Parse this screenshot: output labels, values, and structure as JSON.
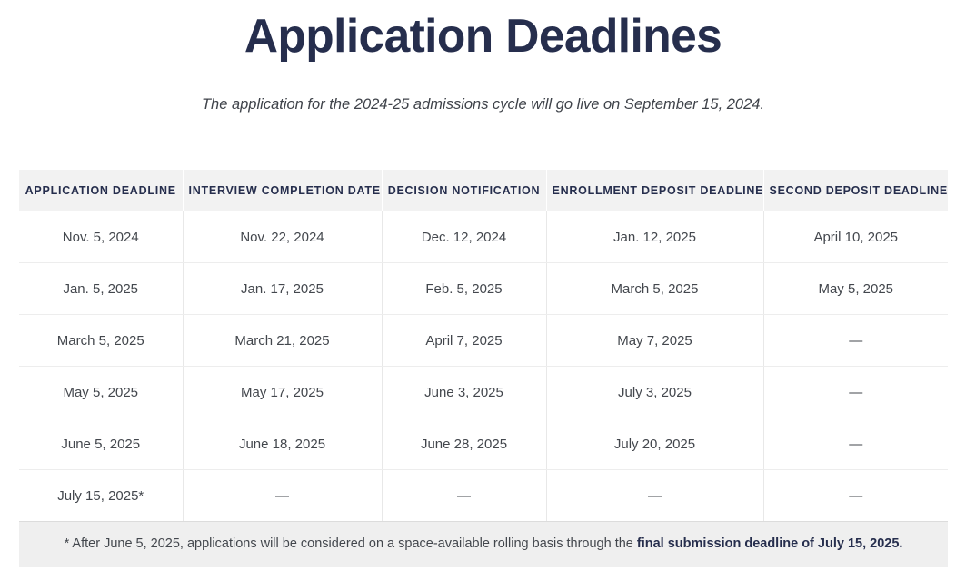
{
  "page_title": "Application Deadlines",
  "subtitle": "The application for the 2024-25 admissions cycle will go live on September 15, 2024.",
  "table": {
    "headers": [
      "APPLICATION DEADLINE",
      "INTERVIEW COMPLETION DATE",
      "DECISION NOTIFICATION",
      "ENROLLMENT DEPOSIT DEADLINE",
      "SECOND DEPOSIT DEADLINE"
    ],
    "rows": [
      [
        "Nov. 5, 2024",
        "Nov. 22, 2024",
        "Dec. 12, 2024",
        "Jan. 12, 2025",
        "April 10, 2025"
      ],
      [
        "Jan. 5, 2025",
        "Jan. 17, 2025",
        "Feb. 5, 2025",
        "March 5, 2025",
        "May 5, 2025"
      ],
      [
        "March 5, 2025",
        "March 21, 2025",
        "April 7, 2025",
        "May 7, 2025",
        "—"
      ],
      [
        "May 5, 2025",
        "May 17, 2025",
        "June 3, 2025",
        "July 3, 2025",
        "—"
      ],
      [
        "June 5, 2025",
        "June 18, 2025",
        "June 28, 2025",
        "July 20, 2025",
        "—"
      ],
      [
        "July 15, 2025*",
        "—",
        "—",
        "—",
        "—"
      ]
    ]
  },
  "footnote": {
    "lead": "* After June 5, 2025, applications will be considered on a space-available rolling basis through the ",
    "emphasis": "final submission deadline of July 15, 2025."
  },
  "colors": {
    "title": "#262e4d",
    "header_bg": "#f2f2f2",
    "footnote_bg": "#efefef",
    "body_text": "#43474d"
  }
}
